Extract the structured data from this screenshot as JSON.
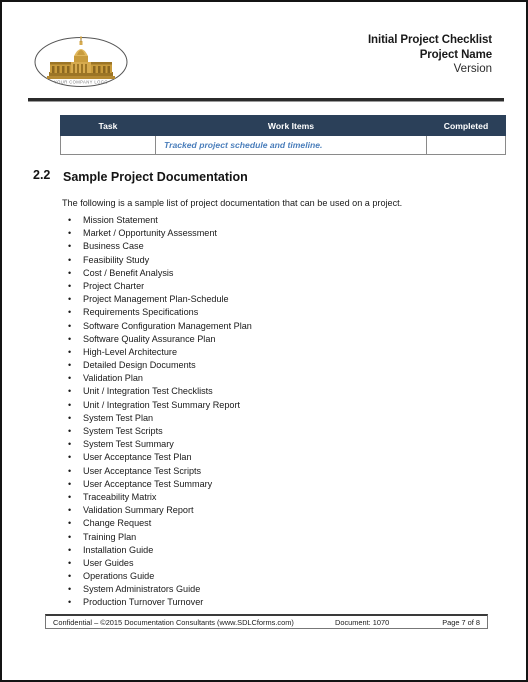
{
  "header": {
    "title_line1": "Initial Project Checklist",
    "title_line2": "Project Name",
    "title_line3": "Version",
    "logo_text": "YOUR COMPANY LOGO"
  },
  "table": {
    "columns": [
      "Task",
      "Work Items",
      "Completed"
    ],
    "rows": [
      {
        "task": "",
        "work_items": "Tracked project schedule and timeline.",
        "completed": ""
      }
    ]
  },
  "section": {
    "number": "2.2",
    "title": "Sample Project Documentation",
    "intro": "The following is a sample list of project documentation that can be used on a project."
  },
  "documentation_list": [
    "Mission Statement",
    "Market / Opportunity Assessment",
    "Business Case",
    "Feasibility Study",
    "Cost / Benefit Analysis",
    "Project Charter",
    "Project Management Plan-Schedule",
    "Requirements Specifications",
    "Software Configuration Management Plan",
    "Software Quality Assurance Plan",
    "High-Level Architecture",
    "Detailed Design Documents",
    "Validation Plan",
    "Unit / Integration Test Checklists",
    "Unit / Integration Test Summary Report",
    "System Test Plan",
    "System Test Scripts",
    "System Test Summary",
    "User Acceptance Test Plan",
    "User Acceptance Test Scripts",
    "User Acceptance Test Summary",
    "Traceability Matrix",
    "Validation Summary Report",
    "Change Request",
    "Training Plan",
    "Installation Guide",
    "User Guides",
    "Operations Guide",
    "System Administrators Guide",
    "Production Turnover Turnover"
  ],
  "footer": {
    "confidential": "Confidential – ©2015 Documentation Consultants (www.SDLCforms.com)",
    "document": "Document: 1070",
    "page": "Page 7 of 8"
  },
  "colors": {
    "table_header_bg": "#2b4059",
    "work_item_text": "#4a7ebb",
    "logo_gold": "#c89b3c",
    "rule": "#2b2b2b"
  },
  "bullet_glyph": "•"
}
